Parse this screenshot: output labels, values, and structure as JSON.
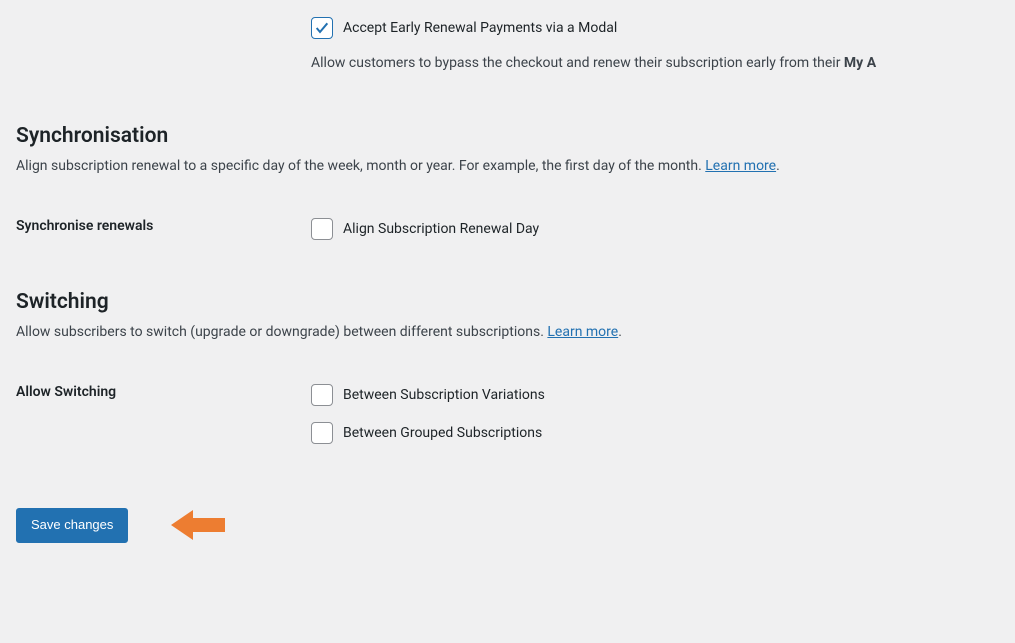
{
  "early_renewal": {
    "checkbox_label": "Accept Early Renewal Payments via a Modal",
    "description_prefix": "Allow customers to bypass the checkout and renew their subscription early from their ",
    "description_bold": "My A"
  },
  "synchronisation": {
    "heading": "Synchronisation",
    "description": "Align subscription renewal to a specific day of the week, month or year. For example, the first day of the month. ",
    "learn_more": "Learn more",
    "period": ".",
    "field_label": "Synchronise renewals",
    "checkbox_label": "Align Subscription Renewal Day"
  },
  "switching": {
    "heading": "Switching",
    "description": "Allow subscribers to switch (upgrade or downgrade) between different subscriptions. ",
    "learn_more": "Learn more",
    "period": ".",
    "field_label": "Allow Switching",
    "option_variations": "Between Subscription Variations",
    "option_grouped": "Between Grouped Subscriptions"
  },
  "save_button": "Save changes"
}
